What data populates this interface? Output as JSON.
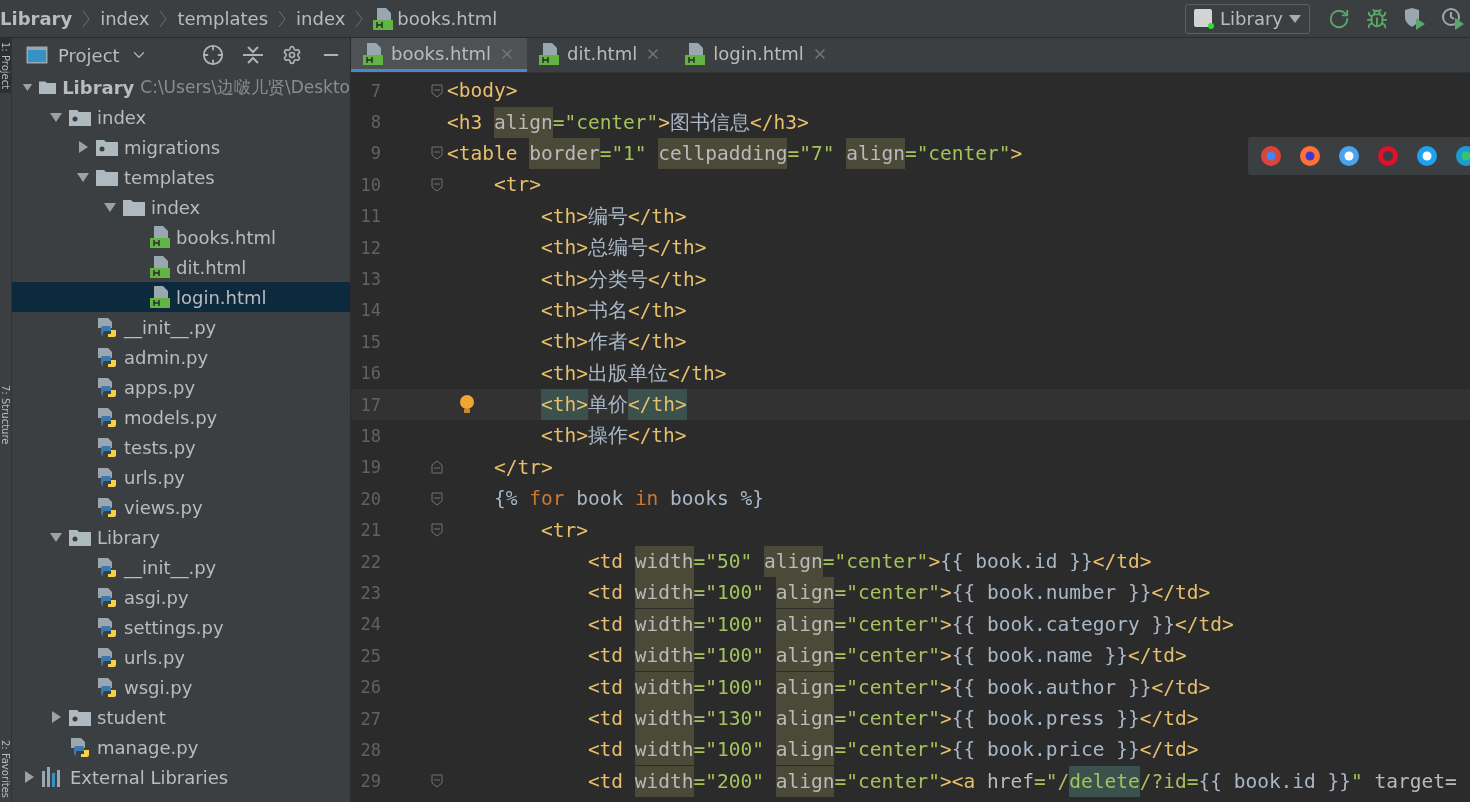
{
  "breadcrumbs": [
    {
      "label": "Library",
      "kind": "root"
    },
    {
      "label": "index",
      "kind": "folder"
    },
    {
      "label": "templates",
      "kind": "folder"
    },
    {
      "label": "index",
      "kind": "folder"
    },
    {
      "label": "books.html",
      "kind": "html"
    }
  ],
  "run_config": {
    "label": "Library"
  },
  "tool_strip": [
    {
      "label": "1: Project",
      "selected": true
    },
    {
      "label": "7: Structure",
      "selected": false
    },
    {
      "label": "2: Favorites",
      "selected": false
    }
  ],
  "project_panel": {
    "title": "Project"
  },
  "tree": [
    {
      "label": "Library",
      "kind": "folder",
      "hint": "C:\\Users\\边啵儿贤\\Deskto",
      "expanded": true,
      "selected": false,
      "children": [
        {
          "label": "index",
          "kind": "package",
          "expanded": true,
          "selected": false,
          "children": [
            {
              "label": "migrations",
              "kind": "package",
              "expanded": false,
              "selected": false
            },
            {
              "label": "templates",
              "kind": "folder",
              "expanded": true,
              "selected": false,
              "children": [
                {
                  "label": "index",
                  "kind": "folder",
                  "expanded": true,
                  "selected": false,
                  "children": [
                    {
                      "label": "books.html",
                      "kind": "html",
                      "selected": false
                    },
                    {
                      "label": "dit.html",
                      "kind": "html",
                      "selected": false
                    },
                    {
                      "label": "login.html",
                      "kind": "html",
                      "selected": true
                    }
                  ]
                }
              ]
            },
            {
              "label": "__init__.py",
              "kind": "python",
              "selected": false
            },
            {
              "label": "admin.py",
              "kind": "python",
              "selected": false
            },
            {
              "label": "apps.py",
              "kind": "python",
              "selected": false
            },
            {
              "label": "models.py",
              "kind": "python",
              "selected": false
            },
            {
              "label": "tests.py",
              "kind": "python",
              "selected": false
            },
            {
              "label": "urls.py",
              "kind": "python",
              "selected": false
            },
            {
              "label": "views.py",
              "kind": "python",
              "selected": false
            }
          ]
        },
        {
          "label": "Library",
          "kind": "package",
          "expanded": true,
          "selected": false,
          "children": [
            {
              "label": "__init__.py",
              "kind": "python",
              "selected": false
            },
            {
              "label": "asgi.py",
              "kind": "python",
              "selected": false
            },
            {
              "label": "settings.py",
              "kind": "python",
              "selected": false
            },
            {
              "label": "urls.py",
              "kind": "python",
              "selected": false
            },
            {
              "label": "wsgi.py",
              "kind": "python",
              "selected": false
            }
          ]
        },
        {
          "label": "student",
          "kind": "package",
          "expanded": false,
          "selected": false
        },
        {
          "label": "manage.py",
          "kind": "python",
          "selected": false
        }
      ]
    },
    {
      "label": "External Libraries",
      "kind": "libraries",
      "expanded": false,
      "selected": false
    }
  ],
  "tabs": [
    {
      "label": "books.html",
      "selected": true
    },
    {
      "label": "dit.html",
      "selected": false
    },
    {
      "label": "login.html",
      "selected": false
    }
  ],
  "code": [
    {
      "number": "7",
      "kind": "fold_start",
      "current": false,
      "tokens": [
        {
          "kind": "tag",
          "text": "<body>"
        }
      ]
    },
    {
      "number": "8",
      "kind": "plain",
      "current": false,
      "tokens": [
        {
          "kind": "tag",
          "text": "<h3 "
        },
        {
          "kind": "attr",
          "text": "align"
        },
        {
          "kind": "val",
          "text": "=\"center\""
        },
        {
          "kind": "tag",
          "text": ">"
        },
        {
          "kind": "text",
          "text": "图书信息"
        },
        {
          "kind": "tag",
          "text": "</h3>"
        }
      ]
    },
    {
      "number": "9",
      "kind": "fold_start",
      "current": false,
      "tokens": [
        {
          "kind": "tag",
          "text": "<table "
        },
        {
          "kind": "attr",
          "text": "border"
        },
        {
          "kind": "val",
          "text": "=\"1\" "
        },
        {
          "kind": "attr",
          "text": "cellpadding"
        },
        {
          "kind": "val",
          "text": "=\"7\" "
        },
        {
          "kind": "attr",
          "text": "align"
        },
        {
          "kind": "val",
          "text": "=\"center\""
        },
        {
          "kind": "tag",
          "text": ">"
        }
      ]
    },
    {
      "number": "10",
      "kind": "fold_start",
      "current": false,
      "tokens": [
        {
          "kind": "tag",
          "text": "    <tr>"
        }
      ]
    },
    {
      "number": "11",
      "kind": "plain",
      "current": false,
      "tokens": [
        {
          "kind": "tag",
          "text": "        <th>"
        },
        {
          "kind": "text",
          "text": "编号"
        },
        {
          "kind": "tag",
          "text": "</th>"
        }
      ]
    },
    {
      "number": "12",
      "kind": "plain",
      "current": false,
      "tokens": [
        {
          "kind": "tag",
          "text": "        <th>"
        },
        {
          "kind": "text",
          "text": "总编号"
        },
        {
          "kind": "tag",
          "text": "</th>"
        }
      ]
    },
    {
      "number": "13",
      "kind": "plain",
      "current": false,
      "tokens": [
        {
          "kind": "tag",
          "text": "        <th>"
        },
        {
          "kind": "text",
          "text": "分类号"
        },
        {
          "kind": "tag",
          "text": "</th>"
        }
      ]
    },
    {
      "number": "14",
      "kind": "plain",
      "current": false,
      "tokens": [
        {
          "kind": "tag",
          "text": "        <th>"
        },
        {
          "kind": "text",
          "text": "书名"
        },
        {
          "kind": "tag",
          "text": "</th>"
        }
      ]
    },
    {
      "number": "15",
      "kind": "plain",
      "current": false,
      "tokens": [
        {
          "kind": "tag",
          "text": "        <th>"
        },
        {
          "kind": "text",
          "text": "作者"
        },
        {
          "kind": "tag",
          "text": "</th>"
        }
      ]
    },
    {
      "number": "16",
      "kind": "plain",
      "current": false,
      "tokens": [
        {
          "kind": "tag",
          "text": "        <th>"
        },
        {
          "kind": "text",
          "text": "出版单位"
        },
        {
          "kind": "tag",
          "text": "</th>"
        }
      ]
    },
    {
      "number": "17",
      "kind": "plain",
      "current": true,
      "tokens": [
        {
          "kind": "tagmatch",
          "text": "<th>"
        },
        {
          "kind": "text",
          "text": "单价"
        },
        {
          "kind": "tagmatch",
          "text": "</th>"
        }
      ]
    },
    {
      "number": "18",
      "kind": "plain",
      "current": false,
      "tokens": [
        {
          "kind": "tag",
          "text": "        <th>"
        },
        {
          "kind": "text",
          "text": "操作"
        },
        {
          "kind": "tag",
          "text": "</th>"
        }
      ]
    },
    {
      "number": "19",
      "kind": "fold_end",
      "current": false,
      "tokens": [
        {
          "kind": "tag",
          "text": "    </tr>"
        }
      ]
    },
    {
      "number": "20",
      "kind": "fold_start",
      "current": false,
      "tokens": [
        {
          "kind": "text",
          "text": "    {% "
        },
        {
          "kind": "kw",
          "text": "for"
        },
        {
          "kind": "text",
          "text": " book "
        },
        {
          "kind": "kw",
          "text": "in"
        },
        {
          "kind": "text",
          "text": " books %}"
        }
      ]
    },
    {
      "number": "21",
      "kind": "fold_start",
      "current": false,
      "tokens": [
        {
          "kind": "tag",
          "text": "        <tr>"
        }
      ]
    },
    {
      "number": "22",
      "kind": "plain",
      "current": false,
      "tokens": [
        {
          "kind": "tag",
          "text": "            <td "
        },
        {
          "kind": "attr",
          "text": "width"
        },
        {
          "kind": "val",
          "text": "=\"50\" "
        },
        {
          "kind": "attr",
          "text": "align"
        },
        {
          "kind": "val",
          "text": "=\"center\""
        },
        {
          "kind": "tag",
          "text": ">"
        },
        {
          "kind": "text",
          "text": "{{ book.id }}"
        },
        {
          "kind": "tag",
          "text": "</td>"
        }
      ]
    },
    {
      "number": "23",
      "kind": "plain",
      "current": false,
      "tokens": [
        {
          "kind": "tag",
          "text": "            <td "
        },
        {
          "kind": "attr",
          "text": "width"
        },
        {
          "kind": "val",
          "text": "=\"100\" "
        },
        {
          "kind": "attr",
          "text": "align"
        },
        {
          "kind": "val",
          "text": "=\"center\""
        },
        {
          "kind": "tag",
          "text": ">"
        },
        {
          "kind": "text",
          "text": "{{ book.number }}"
        },
        {
          "kind": "tag",
          "text": "</td>"
        }
      ]
    },
    {
      "number": "24",
      "kind": "plain",
      "current": false,
      "tokens": [
        {
          "kind": "tag",
          "text": "            <td "
        },
        {
          "kind": "attr",
          "text": "width"
        },
        {
          "kind": "val",
          "text": "=\"100\" "
        },
        {
          "kind": "attr",
          "text": "align"
        },
        {
          "kind": "val",
          "text": "=\"center\""
        },
        {
          "kind": "tag",
          "text": ">"
        },
        {
          "kind": "text",
          "text": "{{ book.category }}"
        },
        {
          "kind": "tag",
          "text": "</td>"
        }
      ]
    },
    {
      "number": "25",
      "kind": "plain",
      "current": false,
      "tokens": [
        {
          "kind": "tag",
          "text": "            <td "
        },
        {
          "kind": "attr",
          "text": "width"
        },
        {
          "kind": "val",
          "text": "=\"100\" "
        },
        {
          "kind": "attr",
          "text": "align"
        },
        {
          "kind": "val",
          "text": "=\"center\""
        },
        {
          "kind": "tag",
          "text": ">"
        },
        {
          "kind": "text",
          "text": "{{ book.name }}"
        },
        {
          "kind": "tag",
          "text": "</td>"
        }
      ]
    },
    {
      "number": "26",
      "kind": "plain",
      "current": false,
      "tokens": [
        {
          "kind": "tag",
          "text": "            <td "
        },
        {
          "kind": "attr",
          "text": "width"
        },
        {
          "kind": "val",
          "text": "=\"100\" "
        },
        {
          "kind": "attr",
          "text": "align"
        },
        {
          "kind": "val",
          "text": "=\"center\""
        },
        {
          "kind": "tag",
          "text": ">"
        },
        {
          "kind": "text",
          "text": "{{ book.author }}"
        },
        {
          "kind": "tag",
          "text": "</td>"
        }
      ]
    },
    {
      "number": "27",
      "kind": "plain",
      "current": false,
      "tokens": [
        {
          "kind": "tag",
          "text": "            <td "
        },
        {
          "kind": "attr",
          "text": "width"
        },
        {
          "kind": "val",
          "text": "=\"130\" "
        },
        {
          "kind": "attr",
          "text": "align"
        },
        {
          "kind": "val",
          "text": "=\"center\""
        },
        {
          "kind": "tag",
          "text": ">"
        },
        {
          "kind": "text",
          "text": "{{ book.press }}"
        },
        {
          "kind": "tag",
          "text": "</td>"
        }
      ]
    },
    {
      "number": "28",
      "kind": "plain",
      "current": false,
      "tokens": [
        {
          "kind": "tag",
          "text": "            <td "
        },
        {
          "kind": "attr",
          "text": "width"
        },
        {
          "kind": "val",
          "text": "=\"100\" "
        },
        {
          "kind": "attr",
          "text": "align"
        },
        {
          "kind": "val",
          "text": "=\"center\""
        },
        {
          "kind": "tag",
          "text": ">"
        },
        {
          "kind": "text",
          "text": "{{ book.price }}"
        },
        {
          "kind": "tag",
          "text": "</td>"
        }
      ]
    },
    {
      "number": "29",
      "kind": "fold_start",
      "current": false,
      "tokens": [
        {
          "kind": "tag",
          "text": "            <td "
        },
        {
          "kind": "attr",
          "text": "width"
        },
        {
          "kind": "val",
          "text": "=\"200\" "
        },
        {
          "kind": "attr",
          "text": "align"
        },
        {
          "kind": "val",
          "text": "=\"center\""
        },
        {
          "kind": "tag",
          "text": "><a "
        },
        {
          "kind": "plainattr",
          "text": "href"
        },
        {
          "kind": "val",
          "text": "=\"/"
        },
        {
          "kind": "valmark",
          "text": "delete"
        },
        {
          "kind": "val",
          "text": "/?id="
        },
        {
          "kind": "text",
          "text": "{{ book.id }}"
        },
        {
          "kind": "val",
          "text": "\" "
        },
        {
          "kind": "plainattr",
          "text": "target="
        }
      ]
    }
  ],
  "browsers": [
    {
      "kind": "chrome"
    },
    {
      "kind": "firefox"
    },
    {
      "kind": "safari"
    },
    {
      "kind": "opera"
    },
    {
      "kind": "ie"
    },
    {
      "kind": "edge"
    }
  ]
}
